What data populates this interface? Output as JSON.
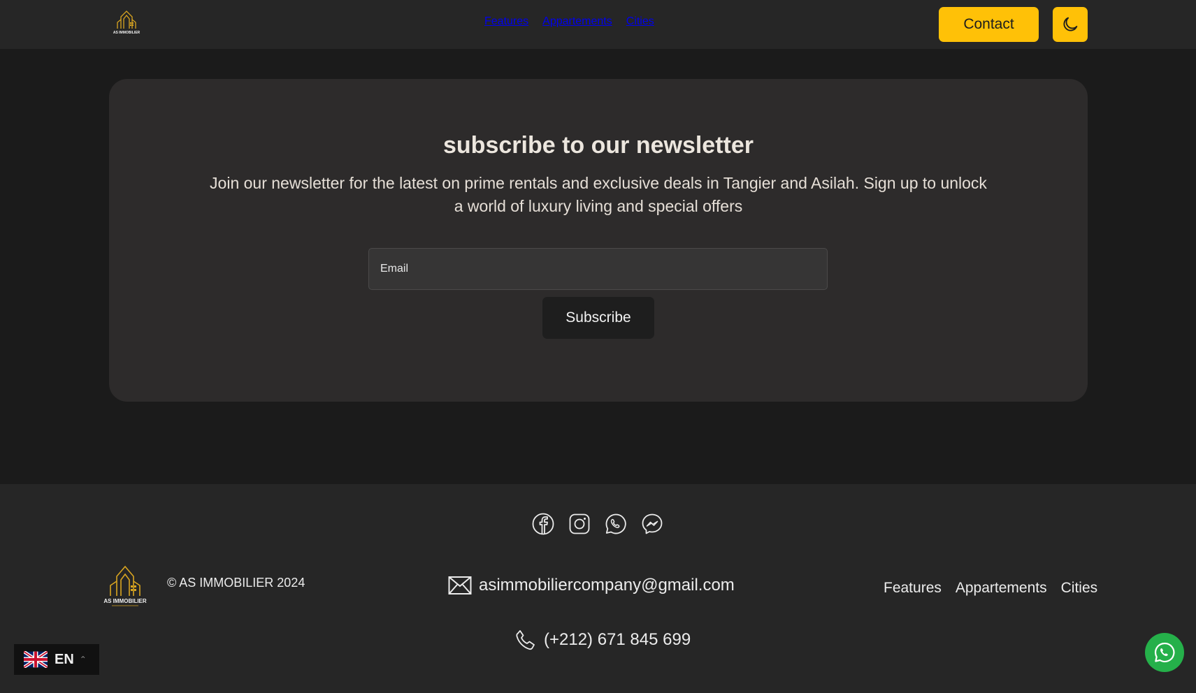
{
  "header": {
    "logo_alt": "AS IMMOBILIER",
    "nav": [
      "Features",
      "Appartements",
      "Cities"
    ],
    "contact_label": "Contact",
    "theme_icon": "moon-icon"
  },
  "newsletter": {
    "title": "subscribe to our newsletter",
    "description": "Join our newsletter for the latest on prime rentals and exclusive deals in Tangier and Asilah. Sign up to unlock a world of luxury living and special offers",
    "email_placeholder": "Email",
    "subscribe_label": "Subscribe"
  },
  "footer": {
    "social_icons": [
      "facebook-icon",
      "instagram-icon",
      "whatsapp-icon",
      "messenger-icon"
    ],
    "copyright": "© AS IMMOBILIER 2024",
    "email": "asimmobiliercompany@gmail.com",
    "phone": "(+212) 671 845 699",
    "nav": [
      "Features",
      "Appartements",
      "Cities"
    ]
  },
  "language": {
    "code": "EN"
  },
  "colors": {
    "accent": "#ffc107",
    "bg": "#1b1b1b",
    "card": "#2d2b2b",
    "whatsapp": "#25b04a"
  }
}
